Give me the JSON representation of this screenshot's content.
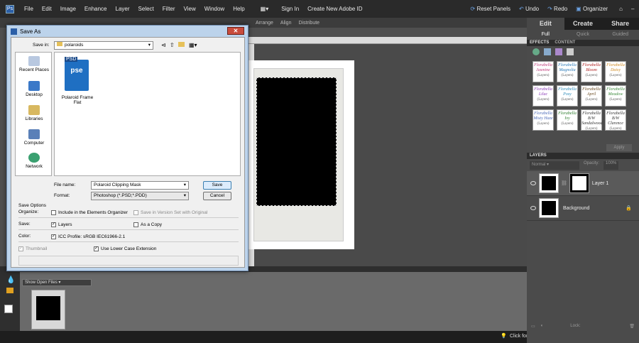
{
  "menubar": {
    "items": [
      "File",
      "Edit",
      "Image",
      "Enhance",
      "Layer",
      "Select",
      "Filter",
      "View",
      "Window",
      "Help"
    ],
    "sign_in": "Sign In",
    "create_id": "Create New Adobe ID",
    "reset_panels": "Reset Panels",
    "undo": "Undo",
    "redo": "Redo",
    "organizer": "Organizer"
  },
  "options_bar": {
    "items": [
      "Arrange",
      "Align",
      "Distribute"
    ]
  },
  "right_panel": {
    "tabs": [
      "Edit",
      "Create",
      "Share"
    ],
    "subtabs": [
      "Full",
      "Quick",
      "Guided"
    ],
    "effects_header": "EFFECTS",
    "content_header": "CONTENT",
    "effects": [
      {
        "name": "Florabella",
        "style": "Jasmine",
        "note": "(Layers)",
        "color": "#c03a7a"
      },
      {
        "name": "Florabella",
        "style": "Magnolia",
        "note": "(Layers)",
        "color": "#2a7ab8"
      },
      {
        "name": "Florabella",
        "style": "Bloom",
        "note": "(Layers)",
        "color": "#b02020"
      },
      {
        "name": "Florabella",
        "style": "Daisy",
        "note": "(Layers)",
        "color": "#d08a20"
      },
      {
        "name": "Florabella",
        "style": "Lilac",
        "note": "(Layers)",
        "color": "#8a3ab8"
      },
      {
        "name": "Florabella",
        "style": "Posy",
        "note": "(Layers)",
        "color": "#2a8ab8"
      },
      {
        "name": "Florabella",
        "style": "April",
        "note": "(Layers)",
        "color": "#6a4a20"
      },
      {
        "name": "Florabella",
        "style": "Meadow",
        "note": "(Layers)",
        "color": "#3a8a3a"
      },
      {
        "name": "Florabella",
        "style": "Misty Haze",
        "note": "(Layers)",
        "color": "#4a6ab8"
      },
      {
        "name": "Florabella",
        "style": "Ivy",
        "note": "(Layers)",
        "color": "#2a7a2a"
      },
      {
        "name": "Florabella",
        "style": "B/W Sandalwood",
        "note": "(Layers)",
        "color": "#333333"
      },
      {
        "name": "Florabella",
        "style": "B/W Clarence",
        "note": "(Layers)",
        "color": "#333333"
      }
    ],
    "apply": "Apply",
    "layers_header": "LAYERS",
    "blend_mode": "Normal",
    "opacity_label": "Opacity:",
    "opacity_value": "100%",
    "layers": [
      {
        "name": "Layer 1"
      },
      {
        "name": "Background"
      }
    ],
    "lock_label": "Lock:"
  },
  "project_bin": {
    "label": "PROJECT BIN",
    "select": "Show Open Files"
  },
  "status": {
    "help": "Click for help creating curving, looping text."
  },
  "dialog": {
    "title": "Save As",
    "save_in_label": "Save in:",
    "save_in_value": "polaroids",
    "places": [
      "Recent Places",
      "Desktop",
      "Libraries",
      "Computer",
      "Network"
    ],
    "file": {
      "icon_text": "PSD",
      "icon_sub": "pse",
      "name": "Polaroid Frame Flat"
    },
    "file_name_label": "File name:",
    "file_name_value": "Polaroid Clipping Mask",
    "format_label": "Format:",
    "format_value": "Photoshop (*.PSD;*.PDD)",
    "save_button": "Save",
    "cancel_button": "Cancel",
    "save_options_label": "Save Options",
    "organize_label": "Organize:",
    "include_organizer": "Include in the Elements Organizer",
    "version_set": "Save in Version Set with Original",
    "save_label": "Save:",
    "layers_opt": "Layers",
    "as_copy": "As a Copy",
    "color_label": "Color:",
    "icc_profile": "ICC Profile:  sRGB IEC61966-2.1",
    "thumbnail": "Thumbnail",
    "lower_case": "Use Lower Case Extension"
  }
}
